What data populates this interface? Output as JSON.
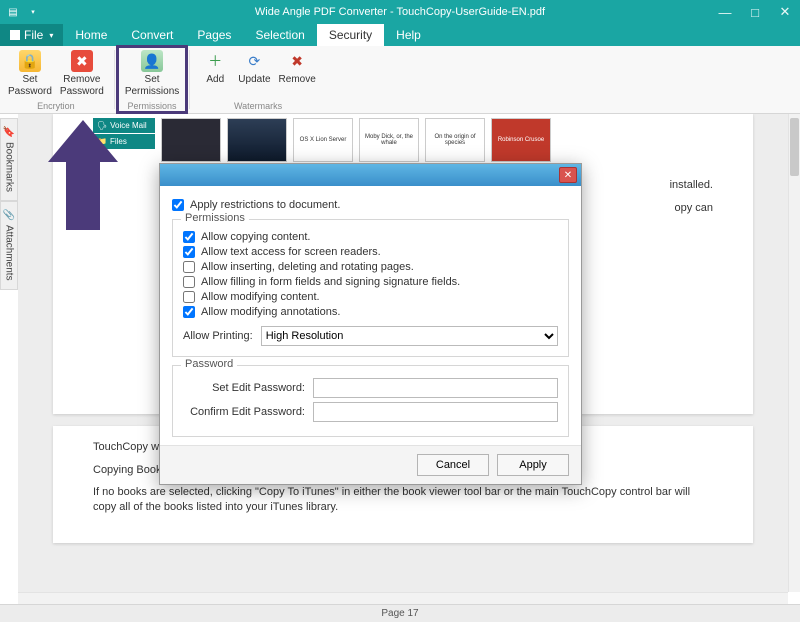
{
  "app_title": "Wide Angle PDF Converter - TouchCopy-UserGuide-EN.pdf",
  "win": {
    "min": "—",
    "max": "□",
    "close": "✕"
  },
  "file_label": "File",
  "tabs": [
    "Home",
    "Convert",
    "Pages",
    "Selection",
    "Security",
    "Help"
  ],
  "active_tab_index": 4,
  "ribbon": {
    "encryption": {
      "set_password": "Set\nPassword",
      "remove_password": "Remove\nPassword",
      "group": "Encrytion"
    },
    "permissions": {
      "set_permissions": "Set\nPermissions",
      "group": "Permissions"
    },
    "watermarks": {
      "add": "Add",
      "update": "Update",
      "remove": "Remove",
      "group": "Watermarks"
    }
  },
  "side": {
    "bookmarks": "Bookmarks",
    "attachments": "Attachments"
  },
  "thumbs": {
    "voice_mail": "Voice Mail",
    "files": "Files",
    "t3": "OS X Lion Server",
    "t4": "Moby Dick, or, the whale",
    "t5": "On the origin of species",
    "t6": "Robinson Crusoe"
  },
  "doc_bg": {
    "line1": "installed.",
    "line2": "opy can",
    "p1": "TouchCopy will display all the books on your iOS device and indicate the format that each book has.",
    "p2": "Copying Books to iTunes",
    "p3": "If no books are selected, clicking \"Copy To iTunes\" in either the book viewer tool bar or the main TouchCopy control bar will copy all of the books listed into your iTunes library."
  },
  "footer": "Page 17",
  "dialog": {
    "apply_restrictions": "Apply restrictions to document.",
    "perm_legend": "Permissions",
    "allow_copy": "Allow copying content.",
    "allow_screen": "Allow text access for screen readers.",
    "allow_insert": "Allow inserting, deleting and rotating pages.",
    "allow_fill": "Allow filling in form fields and signing signature fields.",
    "allow_modify": "Allow modifying content.",
    "allow_annot": "Allow modifying annotations.",
    "allow_print_label": "Allow Printing:",
    "allow_print_value": "High Resolution",
    "pwd_legend": "Password",
    "set_pwd": "Set Edit Password:",
    "confirm_pwd": "Confirm Edit Password:",
    "cancel": "Cancel",
    "apply": "Apply",
    "checked": {
      "restrict": true,
      "copy": true,
      "screen": true,
      "insert": false,
      "fill": false,
      "modify": false,
      "annot": true
    }
  }
}
